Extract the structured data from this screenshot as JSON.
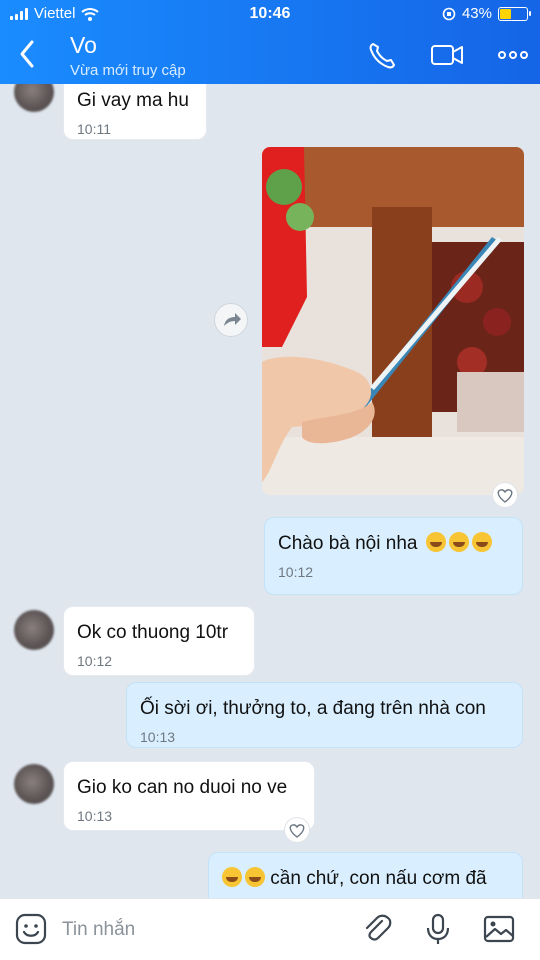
{
  "status": {
    "carrier": "Viettel",
    "time": "10:46",
    "battery": "43%"
  },
  "header": {
    "title": "Vo",
    "subtitle": "Vừa mới truy cập"
  },
  "messages": [
    {
      "text": "Gi vay ma hu",
      "time": "10:11"
    },
    {
      "text": "Chào bà nội nha",
      "time": "10:12"
    },
    {
      "text": "Ok co thuong 10tr",
      "time": "10:12"
    },
    {
      "text": "Ối sời ơi, thưởng to, a đang trên nhà con",
      "time": "10:13"
    },
    {
      "text": "Gio ko can no duoi no ve",
      "time": "10:13"
    },
    {
      "text": "cần chứ, con nấu cơm đã"
    }
  ],
  "composer": {
    "placeholder": "Tin nhắn"
  },
  "colors": {
    "header": "#1a8cff",
    "out_bubble": "#d9efff",
    "in_bubble": "#ffffff",
    "background": "#dfe6ee"
  },
  "icons": [
    "back-icon",
    "phone-icon",
    "video-call-icon",
    "more-icon",
    "share-icon",
    "heart-icon",
    "sticker-icon",
    "attach-icon",
    "mic-icon",
    "image-icon"
  ]
}
